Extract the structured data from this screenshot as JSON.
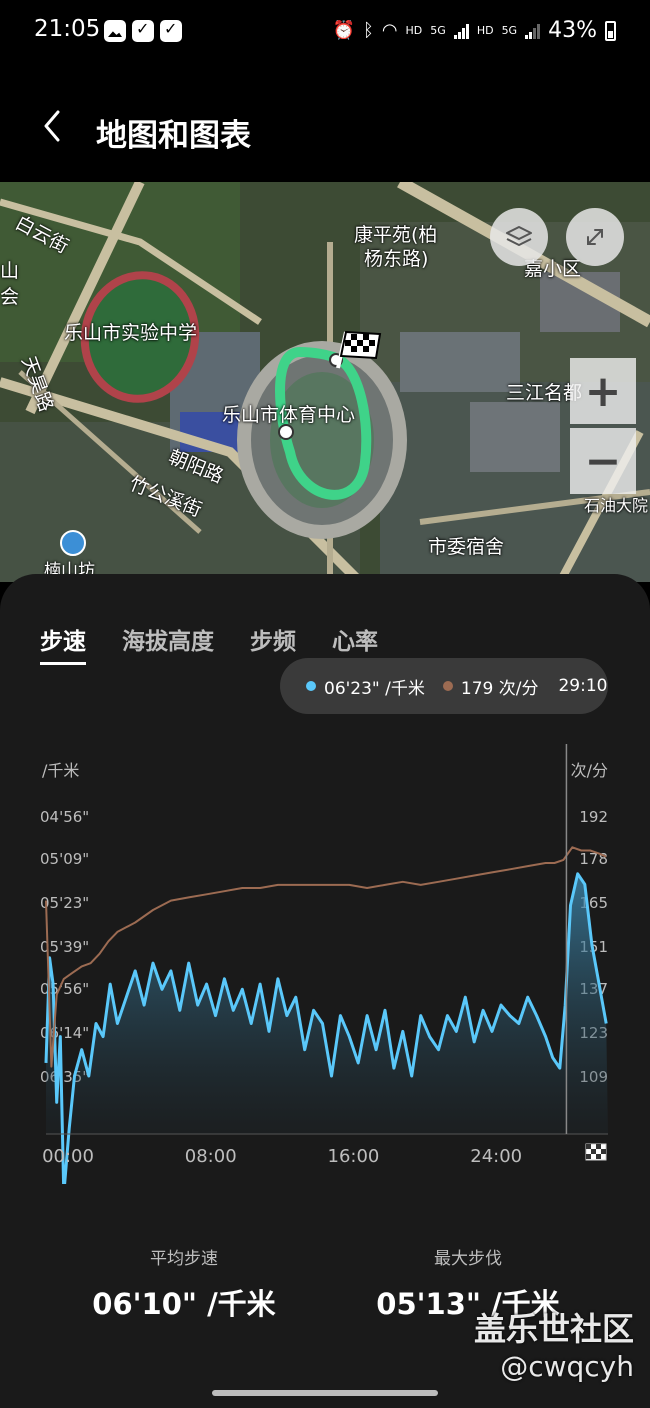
{
  "status_bar": {
    "time": "21:05",
    "network_1": "HD",
    "network_2": "5G",
    "network_3": "HD",
    "network_4": "5G",
    "battery": "43%",
    "icons": [
      "gallery-icon",
      "check-icon",
      "check-icon",
      "alarm-icon",
      "bluetooth-icon",
      "wifi-icon",
      "signal-icon",
      "signal-icon",
      "battery-icon"
    ]
  },
  "header": {
    "title": "地图和图表",
    "back_icon": "chevron-left-icon"
  },
  "map": {
    "labels": {
      "baiyun": "白云街",
      "shan": "山",
      "hui": "会",
      "school": "乐山市实验中学",
      "tianpu": "天昊路",
      "kangping_1": "康平苑(柏",
      "kangping_2": "杨东路)",
      "jia": "嘉小区",
      "sanjiang": "三江名都",
      "stadium": "乐山市体育中心",
      "chaoyang": "朝阳路",
      "zhugong": "竹公溪街",
      "shiyou": "石油大院",
      "shiwei": "市委宿舍",
      "nanshan": "楠山坊"
    },
    "layers_icon": "layers-icon",
    "expand_icon": "expand-icon",
    "zoom_in": "+",
    "zoom_out": "−",
    "flag_icon": "finish-flag-icon"
  },
  "tabs": [
    {
      "label": "步速",
      "active": true
    },
    {
      "label": "海拔高度",
      "active": false
    },
    {
      "label": "步频",
      "active": false
    },
    {
      "label": "心率",
      "active": false
    }
  ],
  "tooltip": {
    "pace": "06'23\" /千米",
    "cadence": "179 次/分",
    "time": "29:10",
    "pace_color": "#5ac8fa",
    "cadence_color": "#9c6b52"
  },
  "chart_data": {
    "type": "line",
    "left_unit": "/千米",
    "right_unit": "次/分",
    "y_left_ticks": [
      "04'56\"",
      "05'09\"",
      "05'23\"",
      "05'39\"",
      "05'56\"",
      "06'14\"",
      "06'35\""
    ],
    "y_right_ticks": [
      "192",
      "178",
      "165",
      "151",
      "137",
      "123",
      "109"
    ],
    "x_ticks": [
      "00:00",
      "08:00",
      "16:00",
      "24:00"
    ],
    "x_range_minutes": [
      0,
      31.5
    ],
    "tooltip_time_minutes": 29.17,
    "series": [
      {
        "name": "步速",
        "unit": "/千米",
        "color": "#5ac8fa",
        "x": [
          0,
          0.2,
          0.4,
          0.6,
          0.8,
          1.0,
          1.3,
          1.6,
          2.0,
          2.4,
          2.8,
          3.2,
          3.6,
          4.0,
          4.5,
          5.0,
          5.5,
          6.0,
          6.5,
          7.0,
          7.5,
          8.0,
          8.5,
          9.0,
          9.5,
          10.0,
          10.5,
          11.0,
          11.5,
          12.0,
          12.5,
          13.0,
          13.5,
          14.0,
          14.5,
          15.0,
          15.5,
          16.0,
          16.5,
          17.0,
          17.5,
          18.0,
          18.5,
          19.0,
          19.5,
          20.0,
          20.5,
          21.0,
          21.5,
          22.0,
          22.5,
          23.0,
          23.5,
          24.0,
          24.5,
          25.0,
          25.5,
          26.0,
          26.5,
          27.0,
          27.5,
          28.0,
          28.4,
          28.8,
          29.1,
          29.4,
          29.8,
          30.2,
          30.6,
          31.0,
          31.4
        ],
        "values": [
          390,
          350,
          360,
          405,
          380,
          440,
          415,
          395,
          385,
          395,
          375,
          380,
          360,
          375,
          365,
          355,
          368,
          352,
          362,
          355,
          370,
          352,
          368,
          360,
          372,
          358,
          370,
          362,
          375,
          360,
          378,
          358,
          372,
          365,
          385,
          370,
          375,
          395,
          372,
          380,
          390,
          372,
          385,
          370,
          392,
          378,
          395,
          372,
          380,
          385,
          372,
          378,
          365,
          382,
          370,
          378,
          368,
          372,
          375,
          365,
          372,
          380,
          388,
          392,
          368,
          330,
          318,
          322,
          345,
          360,
          375
        ]
      },
      {
        "name": "步频",
        "unit": "次/分",
        "color": "#9c6b52",
        "x": [
          0,
          0.3,
          0.6,
          1.0,
          1.5,
          2.0,
          2.5,
          3.0,
          3.5,
          4.0,
          5.0,
          6.0,
          7.0,
          8.0,
          9.0,
          10.0,
          11.0,
          12.0,
          13.0,
          14.0,
          15.0,
          16.0,
          17.0,
          18.0,
          19.0,
          20.0,
          21.0,
          22.0,
          23.0,
          24.0,
          25.0,
          26.0,
          27.0,
          28.0,
          28.5,
          29.0,
          29.5,
          30.0,
          30.5,
          31.0,
          31.4
        ],
        "values": [
          165,
          112,
          135,
          140,
          142,
          144,
          145,
          148,
          152,
          155,
          158,
          162,
          165,
          166,
          167,
          168,
          169,
          169,
          170,
          170,
          170,
          170,
          170,
          169,
          170,
          171,
          170,
          171,
          172,
          173,
          174,
          175,
          176,
          177,
          177,
          178,
          182,
          181,
          181,
          180,
          179
        ]
      }
    ]
  },
  "stats": [
    {
      "label": "平均步速",
      "value": "06'10\" /千米"
    },
    {
      "label": "最大步伐",
      "value": "05'13\" /千米"
    }
  ],
  "watermark": {
    "site": "盖乐世社区",
    "user": "@cwqcyh"
  }
}
